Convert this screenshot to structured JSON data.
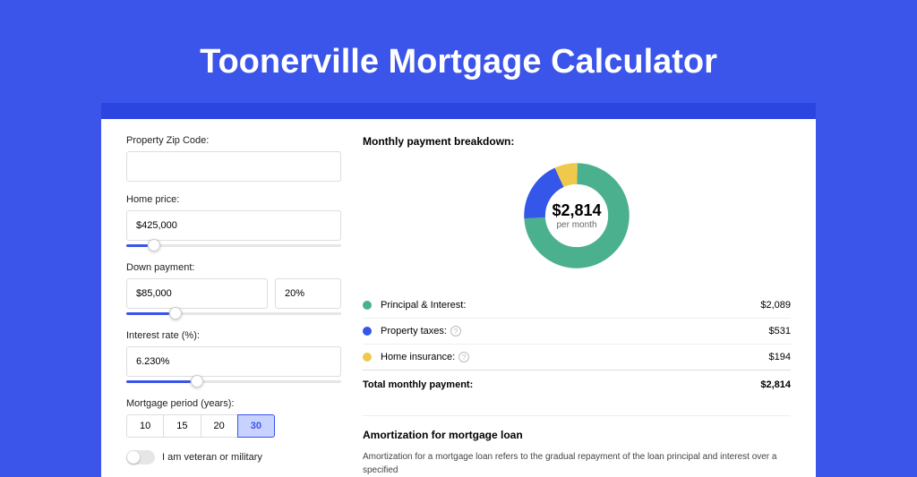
{
  "title": "Toonerville Mortgage Calculator",
  "form": {
    "zip_label": "Property Zip Code:",
    "zip_value": "",
    "home_price_label": "Home price:",
    "home_price_value": "$425,000",
    "home_price_slider_pct": 10,
    "down_payment_label": "Down payment:",
    "down_payment_value": "$85,000",
    "down_payment_pct": "20%",
    "down_payment_slider_pct": 20,
    "rate_label": "Interest rate (%):",
    "rate_value": "6.230%",
    "rate_slider_pct": 30,
    "period_label": "Mortgage period (years):",
    "periods": [
      "10",
      "15",
      "20",
      "30"
    ],
    "period_active": "30",
    "veteran_label": "I am veteran or military"
  },
  "breakdown": {
    "title": "Monthly payment breakdown:",
    "center_amount": "$2,814",
    "center_sub": "per month",
    "rows": [
      {
        "color": "green",
        "label": "Principal & Interest:",
        "value": "$2,089",
        "help": false
      },
      {
        "color": "blue",
        "label": "Property taxes:",
        "value": "$531",
        "help": true
      },
      {
        "color": "yellow",
        "label": "Home insurance:",
        "value": "$194",
        "help": true
      }
    ],
    "total_label": "Total monthly payment:",
    "total_value": "$2,814"
  },
  "amort": {
    "title": "Amortization for mortgage loan",
    "text": "Amortization for a mortgage loan refers to the gradual repayment of the loan principal and interest over a specified"
  },
  "chart_data": {
    "type": "pie",
    "title": "Monthly payment breakdown",
    "series": [
      {
        "name": "Principal & Interest",
        "value": 2089,
        "color": "#4ab08d"
      },
      {
        "name": "Property taxes",
        "value": 531,
        "color": "#3456e9"
      },
      {
        "name": "Home insurance",
        "value": 194,
        "color": "#efc94c"
      }
    ],
    "total": 2814,
    "unit": "USD per month"
  }
}
